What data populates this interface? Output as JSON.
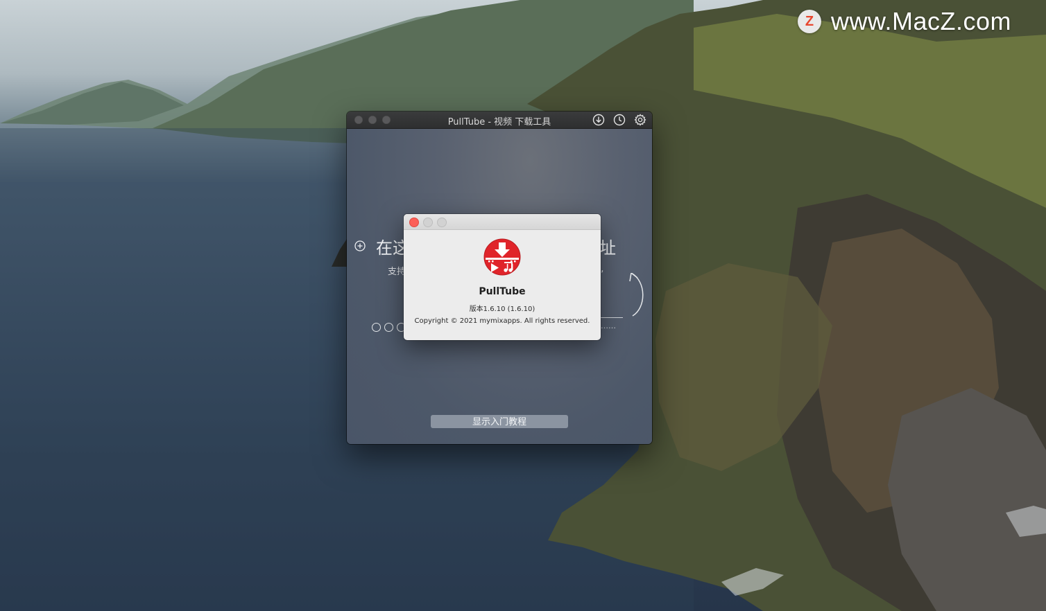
{
  "watermark": {
    "logo_letter": "Z",
    "text": "www.MacZ.com"
  },
  "main_window": {
    "title": "PullTube - 视频 下载工具",
    "toolbar_icons": [
      "download-icon",
      "history-clock-icon",
      "gear-icon"
    ],
    "headline_left": "在这",
    "headline_right": "址",
    "support_left": "支持",
    "support_right": "n,",
    "url_placeholder_dots": "……",
    "tutorial_button": "显示入门教程"
  },
  "about_dialog": {
    "app_name": "PullTube",
    "version": "版本1.6.10 (1.6.10)",
    "copyright": "Copyright © 2021 mymixapps. All rights reserved."
  },
  "colors": {
    "close_red": "#fc5f57",
    "logo_red": "#e0242a",
    "titlebar_dark": "#2e2f30",
    "button_gray": "#8b94a1"
  }
}
